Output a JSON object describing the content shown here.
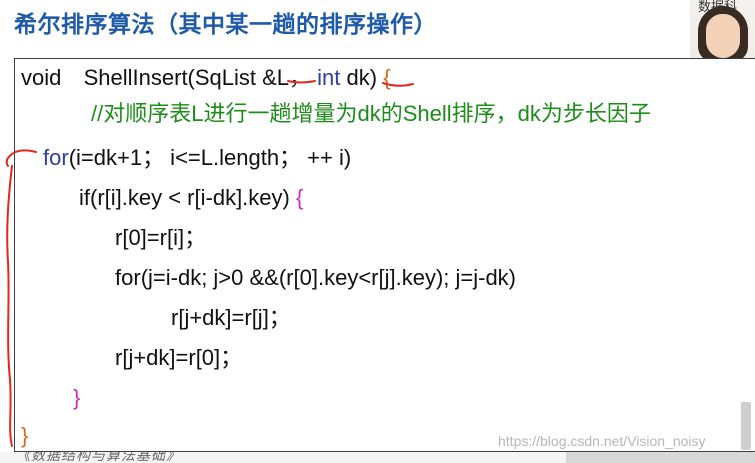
{
  "slide": {
    "title": "希尔排序算法（其中某一趟的排序操作）",
    "code": {
      "line1": {
        "void": "void",
        "fn": "ShellInsert(SqList &L，",
        "int": "int",
        "dk": "dk)",
        "brace_open": "{"
      },
      "comment": "//对顺序表L进行一趟增量为dk的Shell排序，dk为步长因子",
      "for_outer": {
        "for_kw": "for",
        "rest": "(i=dk+1；  i<=L.length；  ++ i)"
      },
      "if_line": {
        "if_kw": "if",
        "cond": "(r[i].key < r[i-dk].key)",
        "brace_open": "{"
      },
      "stmt_r0": "r[0]=r[i]；",
      "for_inner": {
        "for_kw": "for",
        "rest": "(j=i-dk; j>0 &&(r[0].key<r[j].key); j=j-dk)"
      },
      "stmt_shift": "r[j+dk]=r[j]；",
      "stmt_place": "r[j+dk]=r[0]；",
      "brace_close_inner": "}",
      "brace_close_outer": "}"
    },
    "watermark": "https://blog.csdn.net/Vision_noisy",
    "footer_left": "《数据结构与算法基础》",
    "footer_right": "数据科"
  },
  "colors": {
    "title": "#1f5aa6",
    "keyword": "#2c3fa6",
    "brace": "#d12bb4",
    "comment": "#1d8d1a",
    "annotation": "#e0281e"
  }
}
